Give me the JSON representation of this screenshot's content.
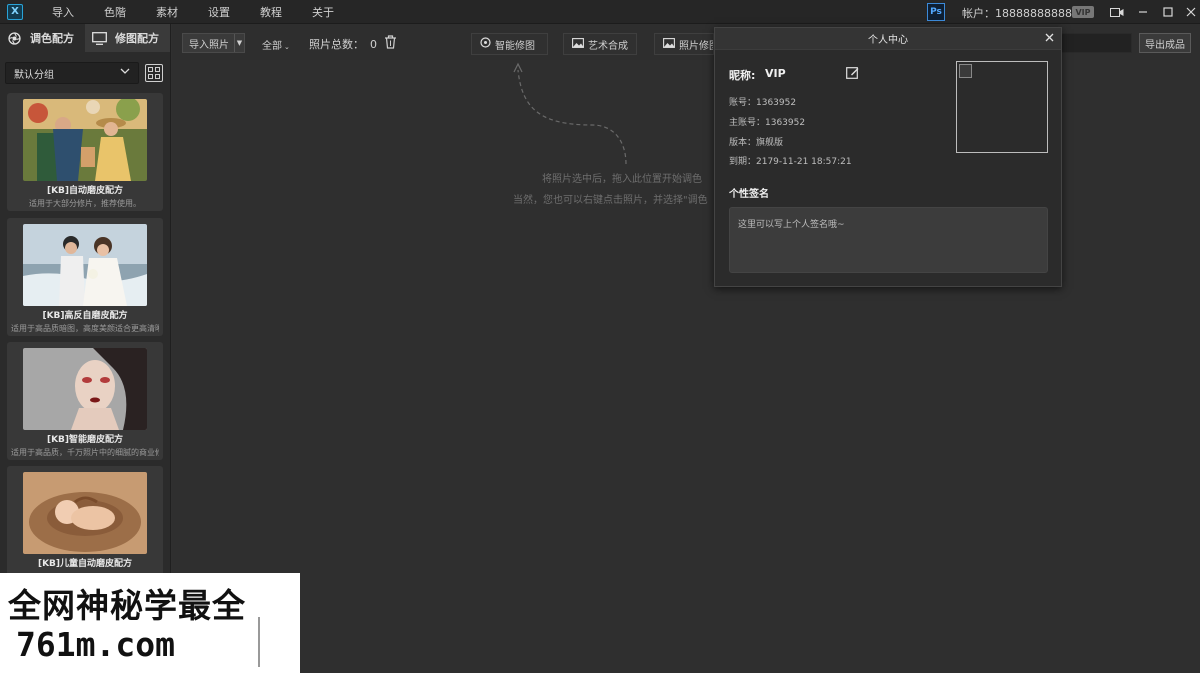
{
  "menubar": {
    "logo": "X",
    "items": [
      "导入",
      "色階",
      "素材",
      "设置",
      "教程",
      "关于"
    ],
    "ps_label": "Ps",
    "account": "帐户：18888888888",
    "vip_badge": "VIP",
    "window_buttons": [
      "⏻",
      "—",
      "☐",
      "✕"
    ]
  },
  "sidebar": {
    "tabs": [
      {
        "label": "调色配方",
        "icon": "aperture-icon"
      },
      {
        "label": "修图配方",
        "icon": "monitor-icon"
      }
    ],
    "group": "默认分组",
    "cards": [
      {
        "title": "[KB]自动磨皮配方",
        "desc": "适用于大部分修片，推荐使用。"
      },
      {
        "title": "[KB]高反自磨皮配方",
        "desc": "适用于高品质暗图，高度美颜适合更高清晰度的..."
      },
      {
        "title": "[KB]智能磨皮配方",
        "desc": "适用于高品质，千万照片中的细腻的商业修图片。..."
      },
      {
        "title": "[KB]儿童自动磨皮配方",
        "desc": ""
      }
    ]
  },
  "toolbar": {
    "import_label": "导入照片",
    "filter_label": "全部",
    "total_label": "照片总数：",
    "total_value": "0",
    "buttons": [
      "智能修图",
      "艺术合成",
      "照片修图"
    ],
    "export_label": "导出成品"
  },
  "main": {
    "hint1": "将照片选中后，拖入此位置开始调色",
    "hint2": "当然，您也可以右键点击照片，并选择\"调色"
  },
  "dialog": {
    "title": "个人中心",
    "nick_label": "昵称:",
    "nick_value": "VIP",
    "account_line": "账号：1363952",
    "main_account_line": "主账号：1363952",
    "version_line": "版本：旗舰版",
    "expiry_line": "到期：2179-11-21 18:57:21",
    "sig_label": "个性签名",
    "sig_placeholder": "这里可以写上个人签名哦~"
  },
  "watermark": {
    "line1": "全网神秘学最全",
    "line2": "761m.com"
  },
  "colors": {
    "background": "#303030",
    "sidebar": "#2b2b2b",
    "card": "#383838",
    "dialog": "#2b2b2b",
    "accent": "#29a3d8"
  }
}
